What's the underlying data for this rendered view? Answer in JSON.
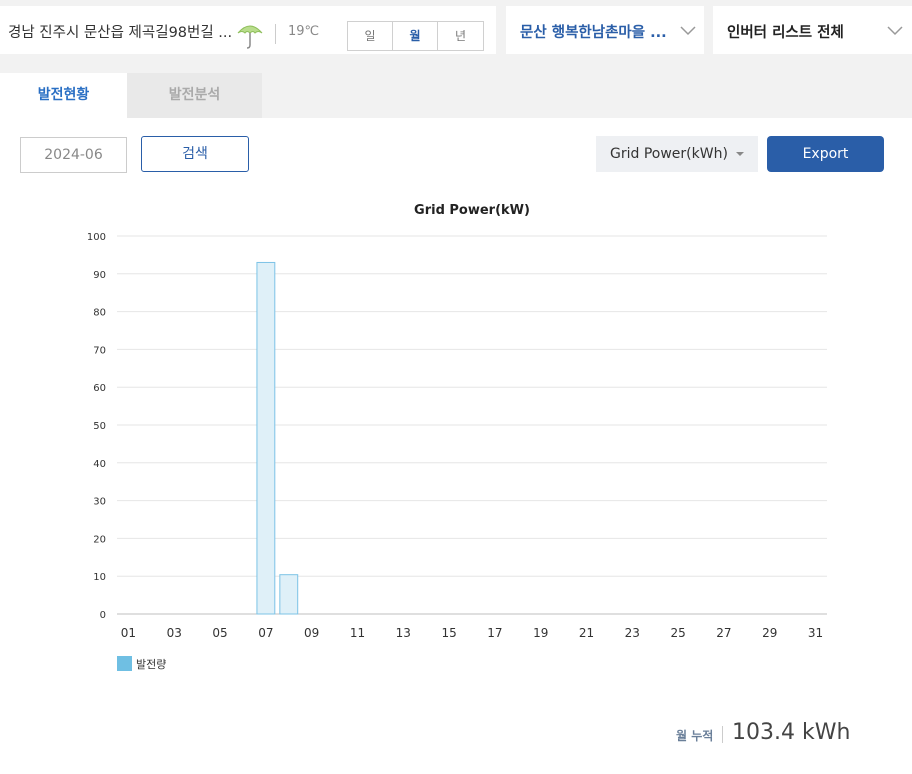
{
  "header": {
    "location": "경남 진주시 문산읍 제곡길98번길 ...",
    "weather_icon": "umbrella-icon",
    "temperature": "19℃",
    "period_tabs": [
      "일",
      "월",
      "년"
    ],
    "active_period": "월",
    "site": "문산 행복한남촌마을 ...",
    "inverter": "인버터 리스트 전체"
  },
  "tabs": [
    {
      "label": "발전현황",
      "active": true
    },
    {
      "label": "발전분석",
      "active": false
    }
  ],
  "controls": {
    "date_value": "2024-06",
    "search_label": "검색",
    "metric_selected": "Grid Power(kWh)",
    "export_label": "Export"
  },
  "colors": {
    "accent": "#2a5ea8",
    "bar_fill": "#dff0f8",
    "bar_stroke": "#7cc3e6",
    "legend_swatch": "#6fbfe3"
  },
  "chart_data": {
    "type": "bar",
    "title": "Grid Power(kW)",
    "xlabel": "",
    "ylabel": "",
    "ylim": [
      0,
      100
    ],
    "yticks": [
      0,
      10,
      20,
      30,
      40,
      50,
      60,
      70,
      80,
      90,
      100
    ],
    "categories": [
      "01",
      "02",
      "03",
      "04",
      "05",
      "06",
      "07",
      "08",
      "09",
      "10",
      "11",
      "12",
      "13",
      "14",
      "15",
      "16",
      "17",
      "18",
      "19",
      "20",
      "21",
      "22",
      "23",
      "24",
      "25",
      "26",
      "27",
      "28",
      "29",
      "30",
      "31"
    ],
    "xtick_labels": [
      "01",
      "03",
      "05",
      "07",
      "09",
      "11",
      "13",
      "15",
      "17",
      "19",
      "21",
      "23",
      "25",
      "27",
      "29",
      "31"
    ],
    "series": [
      {
        "name": "발전량",
        "values": [
          0,
          0,
          0,
          0,
          0,
          0,
          93,
          10.4,
          0,
          0,
          0,
          0,
          0,
          0,
          0,
          0,
          0,
          0,
          0,
          0,
          0,
          0,
          0,
          0,
          0,
          0,
          0,
          0,
          0,
          0,
          0
        ]
      }
    ],
    "grid": true,
    "legend_position": "bottom-left"
  },
  "summary": {
    "label": "월 누적",
    "value": "103.4 kWh"
  }
}
